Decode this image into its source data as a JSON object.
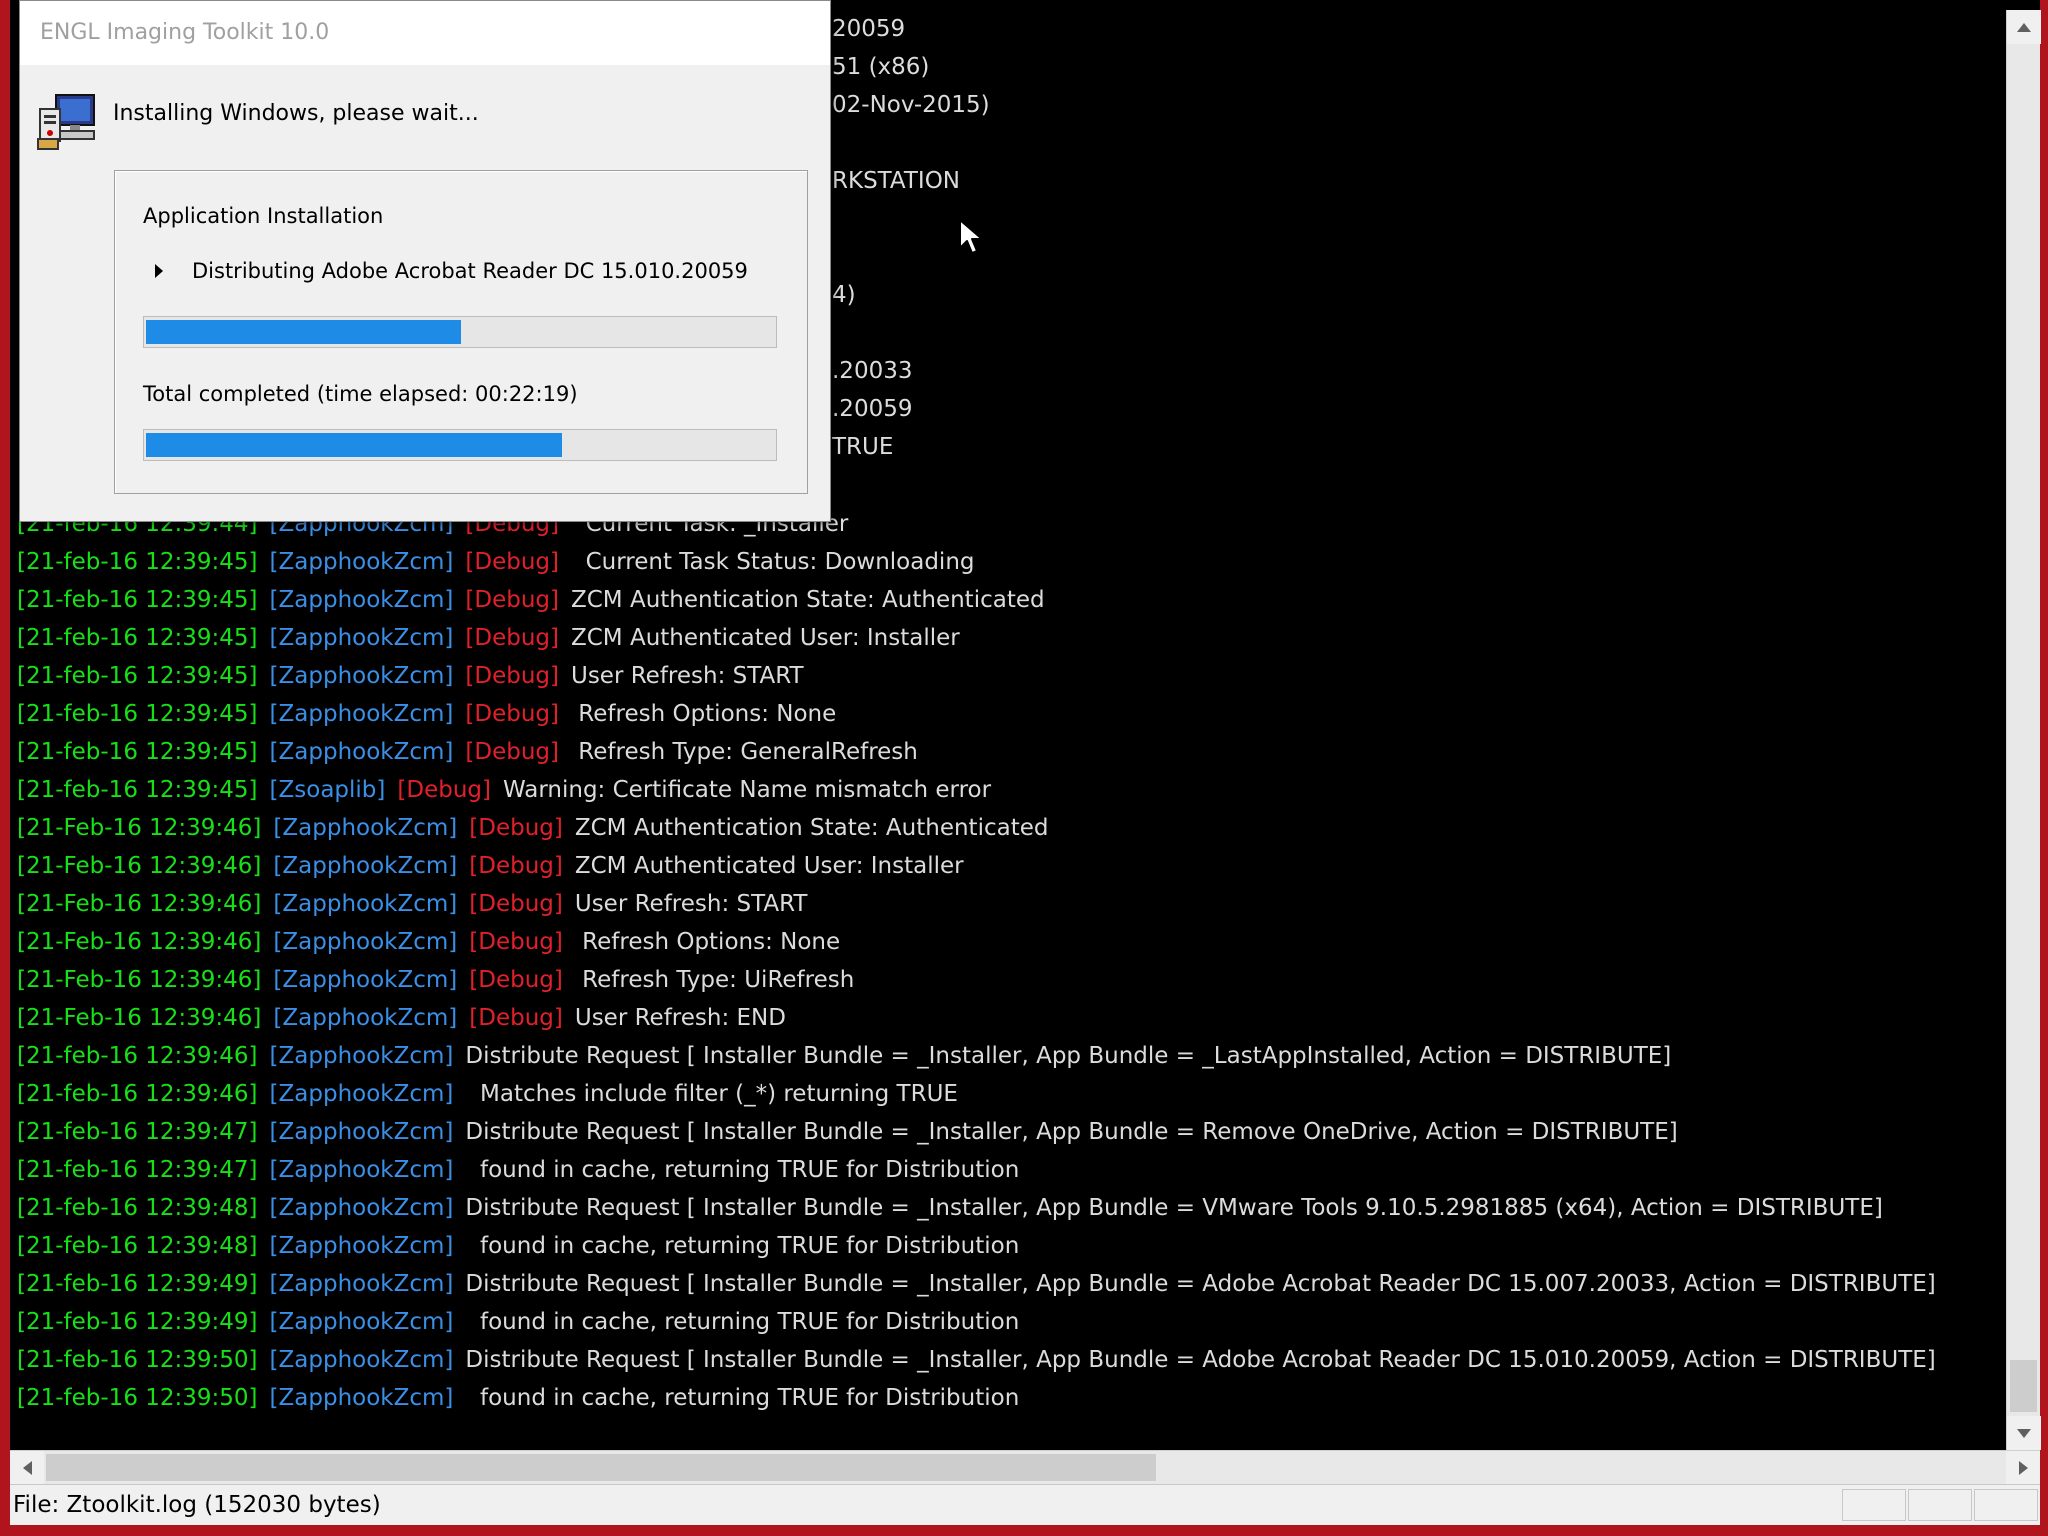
{
  "dialog": {
    "title": "ENGL Imaging Toolkit 10.0",
    "message": "Installing Windows, please wait...",
    "section_label": "Application Installation",
    "current_task": "Distributing Adobe Acrobat Reader DC 15.010.20059",
    "task_progress_pct": 50,
    "total_label": "Total completed  (time elapsed: 00:22:19)",
    "total_progress_pct": 66
  },
  "behind_fragments": [
    {
      "text": "20059"
    },
    {
      "text": "51 (x86)"
    },
    {
      "text": "02-Nov-2015)"
    },
    {
      "text": "RKSTATION"
    },
    {
      "text": "4)"
    },
    {
      "text": ".20033"
    },
    {
      "text": ".20059"
    },
    {
      "text": "TRUE"
    }
  ],
  "log_lines": [
    {
      "ts": "[21-feb-16 12:39:44]",
      "src": "[ZapphookZcm]",
      "lvl": "[Debug]",
      "msg": "  Current Task: _Installer"
    },
    {
      "ts": "[21-feb-16 12:39:45]",
      "src": "[ZapphookZcm]",
      "lvl": "[Debug]",
      "msg": "  Current Task Status: Downloading"
    },
    {
      "ts": "[21-feb-16 12:39:45]",
      "src": "[ZapphookZcm]",
      "lvl": "[Debug]",
      "msg": "ZCM Authentication State: Authenticated"
    },
    {
      "ts": "[21-feb-16 12:39:45]",
      "src": "[ZapphookZcm]",
      "lvl": "[Debug]",
      "msg": "ZCM Authenticated User: Installer"
    },
    {
      "ts": "[21-feb-16 12:39:45]",
      "src": "[ZapphookZcm]",
      "lvl": "[Debug]",
      "msg": "User Refresh: START"
    },
    {
      "ts": "[21-feb-16 12:39:45]",
      "src": "[ZapphookZcm]",
      "lvl": "[Debug]",
      "msg": " Refresh Options: None"
    },
    {
      "ts": "[21-feb-16 12:39:45]",
      "src": "[ZapphookZcm]",
      "lvl": "[Debug]",
      "msg": " Refresh Type: GeneralRefresh"
    },
    {
      "ts": "[21-feb-16 12:39:45]",
      "src": "[Zsoaplib]",
      "lvl": "[Debug]",
      "msg": "Warning: Certificate Name mismatch error"
    },
    {
      "ts": "[21-Feb-16 12:39:46]",
      "src": "[ZapphookZcm]",
      "lvl": "[Debug]",
      "msg": "ZCM Authentication State: Authenticated"
    },
    {
      "ts": "[21-Feb-16 12:39:46]",
      "src": "[ZapphookZcm]",
      "lvl": "[Debug]",
      "msg": "ZCM Authenticated User: Installer"
    },
    {
      "ts": "[21-Feb-16 12:39:46]",
      "src": "[ZapphookZcm]",
      "lvl": "[Debug]",
      "msg": "User Refresh: START"
    },
    {
      "ts": "[21-Feb-16 12:39:46]",
      "src": "[ZapphookZcm]",
      "lvl": "[Debug]",
      "msg": " Refresh Options: None"
    },
    {
      "ts": "[21-Feb-16 12:39:46]",
      "src": "[ZapphookZcm]",
      "lvl": "[Debug]",
      "msg": " Refresh Type: UiRefresh"
    },
    {
      "ts": "[21-Feb-16 12:39:46]",
      "src": "[ZapphookZcm]",
      "lvl": "[Debug]",
      "msg": "User Refresh: END"
    },
    {
      "ts": "[21-feb-16 12:39:46]",
      "src": "[ZapphookZcm]",
      "lvl": "",
      "msg": "Distribute Request [ Installer Bundle = _Installer, App Bundle = _LastAppInstalled, Action = DISTRIBUTE]"
    },
    {
      "ts": "[21-feb-16 12:39:46]",
      "src": "[ZapphookZcm]",
      "lvl": "",
      "msg": "  Matches include filter (_*) returning TRUE"
    },
    {
      "ts": "[21-feb-16 12:39:47]",
      "src": "[ZapphookZcm]",
      "lvl": "",
      "msg": "Distribute Request [ Installer Bundle = _Installer, App Bundle = Remove OneDrive, Action = DISTRIBUTE]"
    },
    {
      "ts": "[21-feb-16 12:39:47]",
      "src": "[ZapphookZcm]",
      "lvl": "",
      "msg": "  found in cache, returning TRUE for Distribution"
    },
    {
      "ts": "[21-feb-16 12:39:48]",
      "src": "[ZapphookZcm]",
      "lvl": "",
      "msg": "Distribute Request [ Installer Bundle = _Installer, App Bundle = VMware Tools 9.10.5.2981885 (x64), Action = DISTRIBUTE]"
    },
    {
      "ts": "[21-feb-16 12:39:48]",
      "src": "[ZapphookZcm]",
      "lvl": "",
      "msg": "  found in cache, returning TRUE for Distribution"
    },
    {
      "ts": "[21-feb-16 12:39:49]",
      "src": "[ZapphookZcm]",
      "lvl": "",
      "msg": "Distribute Request [ Installer Bundle = _Installer, App Bundle = Adobe Acrobat Reader DC 15.007.20033, Action = DISTRIBUTE]"
    },
    {
      "ts": "[21-feb-16 12:39:49]",
      "src": "[ZapphookZcm]",
      "lvl": "",
      "msg": "  found in cache, returning TRUE for Distribution"
    },
    {
      "ts": "[21-feb-16 12:39:50]",
      "src": "[ZapphookZcm]",
      "lvl": "",
      "msg": "Distribute Request [ Installer Bundle = _Installer, App Bundle = Adobe Acrobat Reader DC 15.010.20059, Action = DISTRIBUTE]"
    },
    {
      "ts": "[21-feb-16 12:39:50]",
      "src": "[ZapphookZcm]",
      "lvl": "",
      "msg": "  found in cache, returning TRUE for Distribution"
    }
  ],
  "status_bar": {
    "file_info": "File: Ztoolkit.log (152030 bytes)"
  },
  "colors": {
    "timestamp": "#18e018",
    "source": "#3a8fe6",
    "level": "#e0202a",
    "message": "#dcdcdc",
    "progress": "#1e8be6",
    "desktop": "#b0141c"
  }
}
